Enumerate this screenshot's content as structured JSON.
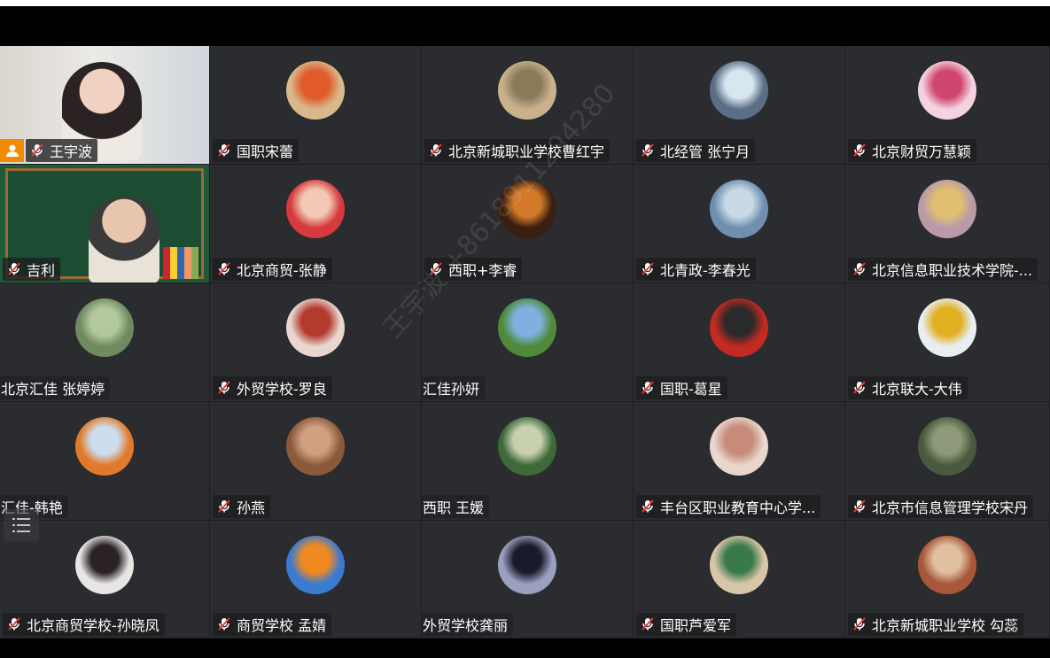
{
  "watermark": "王宇波 +8618911294280",
  "participants": [
    {
      "name": "王宇波",
      "type": "video1",
      "mic": true,
      "host": true
    },
    {
      "name": "国职宋蕾",
      "type": "avatar",
      "color": "#d8b98a",
      "accent": "#e05a2a",
      "mic": true
    },
    {
      "name": "北京新城职业学校曹红宇",
      "type": "avatar",
      "color": "#c9b18c",
      "accent": "#8a7a5a",
      "mic": true
    },
    {
      "name": "北经管 张宁月",
      "type": "avatar",
      "color": "#5a6e86",
      "accent": "#d8e6f0",
      "mic": true
    },
    {
      "name": "北京财贸万慧颖",
      "type": "avatar",
      "color": "#f3d3e0",
      "accent": "#d0466e",
      "mic": true
    },
    {
      "name": "吉利",
      "type": "video2",
      "mic": true
    },
    {
      "name": "北京商贸-张静",
      "type": "avatar",
      "color": "#d63a3e",
      "accent": "#f2c9b4",
      "mic": true
    },
    {
      "name": "西职+李睿",
      "type": "avatar",
      "color": "#3a1e10",
      "accent": "#d27a2a",
      "mic": true
    },
    {
      "name": "北青政-李春光",
      "type": "avatar",
      "color": "#6e8fb0",
      "accent": "#c9d9e6",
      "mic": true
    },
    {
      "name": "北京信息职业技术学院-...",
      "type": "avatar",
      "color": "#b89aa8",
      "accent": "#e0c070",
      "mic": true
    },
    {
      "name": "北京汇佳 张婷婷",
      "type": "avatar",
      "color": "#6e8a5e",
      "accent": "#b4c8a0",
      "mic": false
    },
    {
      "name": "外贸学校-罗良",
      "type": "avatar",
      "color": "#e8d6cf",
      "accent": "#b33a2e",
      "mic": true
    },
    {
      "name": "汇佳孙妍",
      "type": "avatar",
      "color": "#4f8a3a",
      "accent": "#7fb0e0",
      "mic": false
    },
    {
      "name": "国职-葛星",
      "type": "avatar",
      "color": "#c22a22",
      "accent": "#2a2a2a",
      "mic": true
    },
    {
      "name": "北京联大-大伟",
      "type": "avatar",
      "color": "#e8eef2",
      "accent": "#e0b020",
      "mic": true
    },
    {
      "name": "汇佳-韩艳",
      "type": "avatar",
      "color": "#e07a2a",
      "accent": "#cde",
      "mic": false
    },
    {
      "name": "孙燕",
      "type": "avatar",
      "color": "#8a5a3a",
      "accent": "#d0a080",
      "mic": true
    },
    {
      "name": "西职 王媛",
      "type": "avatar",
      "color": "#3e6a3a",
      "accent": "#c9d0b0",
      "mic": false
    },
    {
      "name": "丰台区职业教育中心学...",
      "type": "avatar",
      "color": "#e9d6cc",
      "accent": "#c88a7a",
      "mic": true
    },
    {
      "name": "北京市信息管理学校宋丹",
      "type": "avatar",
      "color": "#4a5a3e",
      "accent": "#8e9a7a",
      "mic": true
    },
    {
      "name": "北京商贸学校-孙晓凤",
      "type": "avatar",
      "color": "#e8e6e4",
      "accent": "#2a2226",
      "mic": true
    },
    {
      "name": "商贸学校 孟婧",
      "type": "avatar",
      "color": "#3a7ad0",
      "accent": "#f08a20",
      "mic": true
    },
    {
      "name": "外贸学校龚丽",
      "type": "avatar",
      "color": "#9aa0c0",
      "accent": "#1a1a2a",
      "mic": false
    },
    {
      "name": "国职芦爱军",
      "type": "avatar",
      "color": "#d9c6a8",
      "accent": "#3a7a4a",
      "mic": true
    },
    {
      "name": "北京新城职业学校 勾蕊",
      "type": "avatar",
      "color": "#a8583a",
      "accent": "#e0c0a0",
      "mic": true
    }
  ]
}
